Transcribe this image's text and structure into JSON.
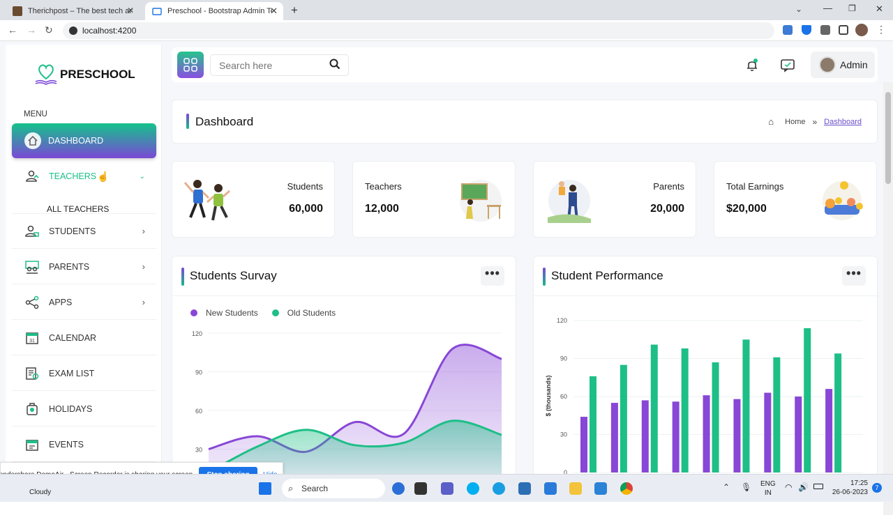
{
  "browser": {
    "tabs": [
      {
        "title": "Therichpost – The best tech and c",
        "active": false
      },
      {
        "title": "Preschool - Bootstrap Admin Tem",
        "active": true
      }
    ],
    "url": "localhost:4200"
  },
  "sidebar": {
    "brand": "PRESCHOOL",
    "menu_label": "MENU",
    "items": [
      {
        "label": "DASHBOARD",
        "icon": "house-icon"
      },
      {
        "label": "TEACHERS",
        "icon": "teacher-icon"
      },
      {
        "label": "STUDENTS",
        "icon": "student-icon"
      },
      {
        "label": "PARENTS",
        "icon": "parents-icon"
      },
      {
        "label": "APPS",
        "icon": "share-icon"
      },
      {
        "label": "CALENDAR",
        "icon": "calendar-icon"
      },
      {
        "label": "EXAM LIST",
        "icon": "exam-icon"
      },
      {
        "label": "HOLIDAYS",
        "icon": "holiday-icon"
      },
      {
        "label": "EVENTS",
        "icon": "events-icon"
      }
    ],
    "submenu": "ALL TEACHERS",
    "calendar_day": "31"
  },
  "header": {
    "search_placeholder": "Search here",
    "user": "Admin"
  },
  "page": {
    "title": "Dashboard",
    "breadcrumb": [
      "Home",
      "Dashboard"
    ]
  },
  "stats": [
    {
      "label": "Students",
      "value": "60,000"
    },
    {
      "label": "Teachers",
      "value": "12,000"
    },
    {
      "label": "Parents",
      "value": "20,000"
    },
    {
      "label": "Total Earnings",
      "value": "$20,000"
    }
  ],
  "colors": {
    "green": "#1dbf86",
    "purple": "#8847d6",
    "accent": "#6a4ec9"
  },
  "chart_data": [
    {
      "type": "area",
      "title": "Students Survay",
      "ylim": [
        0,
        120
      ],
      "yticks": [
        120,
        90,
        60,
        30
      ],
      "series": [
        {
          "name": "New Students",
          "color": "#8847d6",
          "values": [
            30,
            40,
            28,
            51,
            42,
            108,
            100
          ]
        },
        {
          "name": "Old Students",
          "color": "#1dbf86",
          "values": [
            12,
            32,
            45,
            33,
            35,
            52,
            41
          ]
        }
      ]
    },
    {
      "type": "bar",
      "title": "Student Performance",
      "ylabel": "$ (thousands)",
      "ylim": [
        0,
        120
      ],
      "yticks": [
        120,
        90,
        60,
        30,
        0
      ],
      "series": [
        {
          "color": "#8847d6",
          "values": [
            44,
            55,
            57,
            56,
            61,
            58,
            63,
            60,
            66
          ]
        },
        {
          "color": "#1dbf86",
          "values": [
            76,
            85,
            101,
            98,
            87,
            105,
            91,
            114,
            94
          ]
        }
      ]
    }
  ],
  "share_bar": {
    "message": "Wondershare DemoAir - Screen Recorder is sharing your screen.",
    "stop": "Stop sharing",
    "hide": "Hide"
  },
  "taskbar": {
    "weather": "Cloudy",
    "search": "Search",
    "lang": "ENG",
    "region": "IN",
    "time": "17:25",
    "date": "26-06-2023",
    "badge": "7"
  }
}
